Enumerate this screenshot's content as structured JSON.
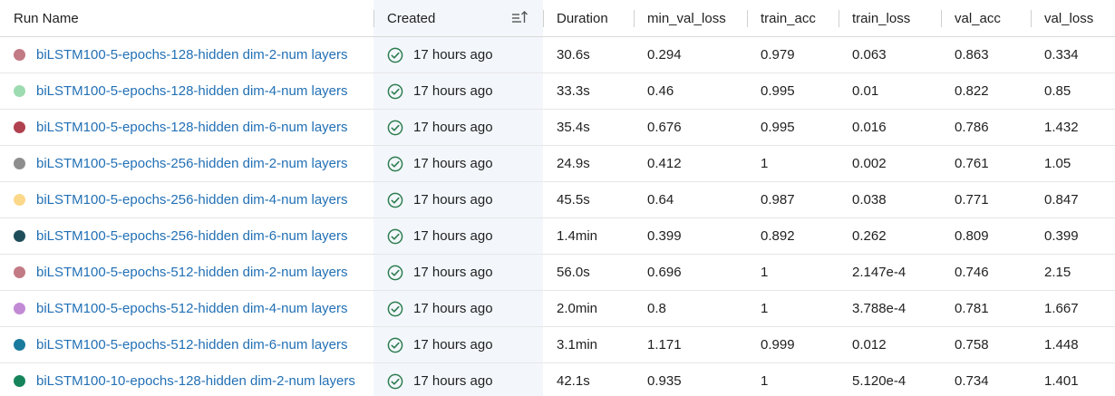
{
  "columns": {
    "run_name": "Run Name",
    "created": "Created",
    "duration": "Duration",
    "min_val_loss": "min_val_loss",
    "train_acc": "train_acc",
    "train_loss": "train_loss",
    "val_acc": "val_acc",
    "val_loss": "val_loss"
  },
  "icons": {
    "sort": "sort-ascending-icon",
    "status": "check-circle-icon"
  },
  "colors": {
    "link": "#2270b5",
    "status_ok": "#2e7d4f",
    "created_column_bg": "#f3f7fc"
  },
  "rows": [
    {
      "color": "#c27a85",
      "run_name": "biLSTM100-5-epochs-128-hidden dim-2-num layers",
      "created": "17 hours ago",
      "duration": "30.6s",
      "min_val_loss": "0.294",
      "train_acc": "0.979",
      "train_loss": "0.063",
      "val_acc": "0.863",
      "val_loss": "0.334"
    },
    {
      "color": "#9ddbb0",
      "run_name": "biLSTM100-5-epochs-128-hidden dim-4-num layers",
      "created": "17 hours ago",
      "duration": "33.3s",
      "min_val_loss": "0.46",
      "train_acc": "0.995",
      "train_loss": "0.01",
      "val_acc": "0.822",
      "val_loss": "0.85"
    },
    {
      "color": "#b0414f",
      "run_name": "biLSTM100-5-epochs-128-hidden dim-6-num layers",
      "created": "17 hours ago",
      "duration": "35.4s",
      "min_val_loss": "0.676",
      "train_acc": "0.995",
      "train_loss": "0.016",
      "val_acc": "0.786",
      "val_loss": "1.432"
    },
    {
      "color": "#8e8e8e",
      "run_name": "biLSTM100-5-epochs-256-hidden dim-2-num layers",
      "created": "17 hours ago",
      "duration": "24.9s",
      "min_val_loss": "0.412",
      "train_acc": "1",
      "train_loss": "0.002",
      "val_acc": "0.761",
      "val_loss": "1.05"
    },
    {
      "color": "#fbd88a",
      "run_name": "biLSTM100-5-epochs-256-hidden dim-4-num layers",
      "created": "17 hours ago",
      "duration": "45.5s",
      "min_val_loss": "0.64",
      "train_acc": "0.987",
      "train_loss": "0.038",
      "val_acc": "0.771",
      "val_loss": "0.847"
    },
    {
      "color": "#1f4e5a",
      "run_name": "biLSTM100-5-epochs-256-hidden dim-6-num layers",
      "created": "17 hours ago",
      "duration": "1.4min",
      "min_val_loss": "0.399",
      "train_acc": "0.892",
      "train_loss": "0.262",
      "val_acc": "0.809",
      "val_loss": "0.399"
    },
    {
      "color": "#c27a85",
      "run_name": "biLSTM100-5-epochs-512-hidden dim-2-num layers",
      "created": "17 hours ago",
      "duration": "56.0s",
      "min_val_loss": "0.696",
      "train_acc": "1",
      "train_loss": "2.147e-4",
      "val_acc": "0.746",
      "val_loss": "2.15"
    },
    {
      "color": "#c28ad4",
      "run_name": "biLSTM100-5-epochs-512-hidden dim-4-num layers",
      "created": "17 hours ago",
      "duration": "2.0min",
      "min_val_loss": "0.8",
      "train_acc": "1",
      "train_loss": "3.788e-4",
      "val_acc": "0.781",
      "val_loss": "1.667"
    },
    {
      "color": "#1a7a9e",
      "run_name": "biLSTM100-5-epochs-512-hidden dim-6-num layers",
      "created": "17 hours ago",
      "duration": "3.1min",
      "min_val_loss": "1.171",
      "train_acc": "0.999",
      "train_loss": "0.012",
      "val_acc": "0.758",
      "val_loss": "1.448"
    },
    {
      "color": "#16845b",
      "run_name": "biLSTM100-10-epochs-128-hidden dim-2-num layers",
      "created": "17 hours ago",
      "duration": "42.1s",
      "min_val_loss": "0.935",
      "train_acc": "1",
      "train_loss": "5.120e-4",
      "val_acc": "0.734",
      "val_loss": "1.401"
    }
  ]
}
